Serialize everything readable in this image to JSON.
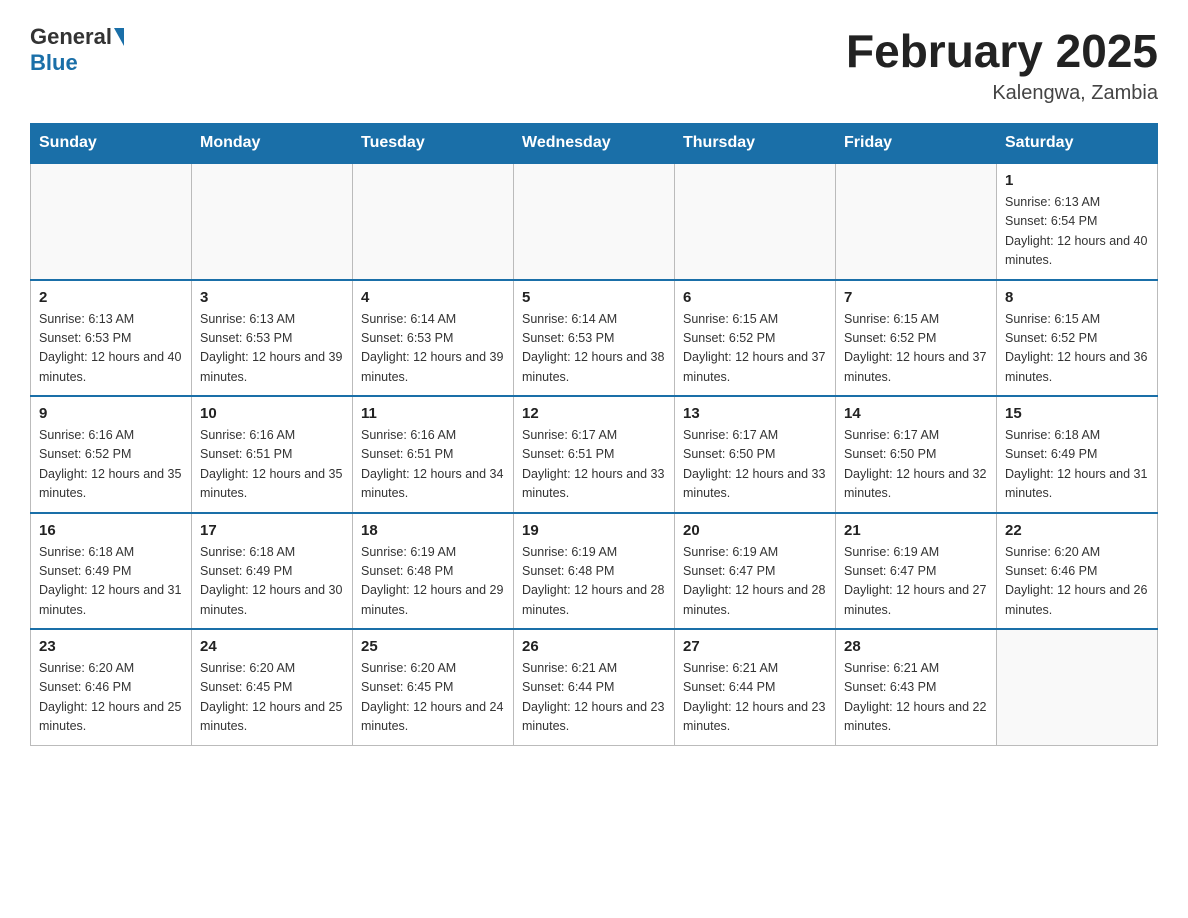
{
  "header": {
    "logo_general": "General",
    "logo_blue": "Blue",
    "month_title": "February 2025",
    "subtitle": "Kalengwa, Zambia"
  },
  "days_of_week": [
    "Sunday",
    "Monday",
    "Tuesday",
    "Wednesday",
    "Thursday",
    "Friday",
    "Saturday"
  ],
  "weeks": [
    [
      {
        "day": "",
        "info": ""
      },
      {
        "day": "",
        "info": ""
      },
      {
        "day": "",
        "info": ""
      },
      {
        "day": "",
        "info": ""
      },
      {
        "day": "",
        "info": ""
      },
      {
        "day": "",
        "info": ""
      },
      {
        "day": "1",
        "info": "Sunrise: 6:13 AM\nSunset: 6:54 PM\nDaylight: 12 hours and 40 minutes."
      }
    ],
    [
      {
        "day": "2",
        "info": "Sunrise: 6:13 AM\nSunset: 6:53 PM\nDaylight: 12 hours and 40 minutes."
      },
      {
        "day": "3",
        "info": "Sunrise: 6:13 AM\nSunset: 6:53 PM\nDaylight: 12 hours and 39 minutes."
      },
      {
        "day": "4",
        "info": "Sunrise: 6:14 AM\nSunset: 6:53 PM\nDaylight: 12 hours and 39 minutes."
      },
      {
        "day": "5",
        "info": "Sunrise: 6:14 AM\nSunset: 6:53 PM\nDaylight: 12 hours and 38 minutes."
      },
      {
        "day": "6",
        "info": "Sunrise: 6:15 AM\nSunset: 6:52 PM\nDaylight: 12 hours and 37 minutes."
      },
      {
        "day": "7",
        "info": "Sunrise: 6:15 AM\nSunset: 6:52 PM\nDaylight: 12 hours and 37 minutes."
      },
      {
        "day": "8",
        "info": "Sunrise: 6:15 AM\nSunset: 6:52 PM\nDaylight: 12 hours and 36 minutes."
      }
    ],
    [
      {
        "day": "9",
        "info": "Sunrise: 6:16 AM\nSunset: 6:52 PM\nDaylight: 12 hours and 35 minutes."
      },
      {
        "day": "10",
        "info": "Sunrise: 6:16 AM\nSunset: 6:51 PM\nDaylight: 12 hours and 35 minutes."
      },
      {
        "day": "11",
        "info": "Sunrise: 6:16 AM\nSunset: 6:51 PM\nDaylight: 12 hours and 34 minutes."
      },
      {
        "day": "12",
        "info": "Sunrise: 6:17 AM\nSunset: 6:51 PM\nDaylight: 12 hours and 33 minutes."
      },
      {
        "day": "13",
        "info": "Sunrise: 6:17 AM\nSunset: 6:50 PM\nDaylight: 12 hours and 33 minutes."
      },
      {
        "day": "14",
        "info": "Sunrise: 6:17 AM\nSunset: 6:50 PM\nDaylight: 12 hours and 32 minutes."
      },
      {
        "day": "15",
        "info": "Sunrise: 6:18 AM\nSunset: 6:49 PM\nDaylight: 12 hours and 31 minutes."
      }
    ],
    [
      {
        "day": "16",
        "info": "Sunrise: 6:18 AM\nSunset: 6:49 PM\nDaylight: 12 hours and 31 minutes."
      },
      {
        "day": "17",
        "info": "Sunrise: 6:18 AM\nSunset: 6:49 PM\nDaylight: 12 hours and 30 minutes."
      },
      {
        "day": "18",
        "info": "Sunrise: 6:19 AM\nSunset: 6:48 PM\nDaylight: 12 hours and 29 minutes."
      },
      {
        "day": "19",
        "info": "Sunrise: 6:19 AM\nSunset: 6:48 PM\nDaylight: 12 hours and 28 minutes."
      },
      {
        "day": "20",
        "info": "Sunrise: 6:19 AM\nSunset: 6:47 PM\nDaylight: 12 hours and 28 minutes."
      },
      {
        "day": "21",
        "info": "Sunrise: 6:19 AM\nSunset: 6:47 PM\nDaylight: 12 hours and 27 minutes."
      },
      {
        "day": "22",
        "info": "Sunrise: 6:20 AM\nSunset: 6:46 PM\nDaylight: 12 hours and 26 minutes."
      }
    ],
    [
      {
        "day": "23",
        "info": "Sunrise: 6:20 AM\nSunset: 6:46 PM\nDaylight: 12 hours and 25 minutes."
      },
      {
        "day": "24",
        "info": "Sunrise: 6:20 AM\nSunset: 6:45 PM\nDaylight: 12 hours and 25 minutes."
      },
      {
        "day": "25",
        "info": "Sunrise: 6:20 AM\nSunset: 6:45 PM\nDaylight: 12 hours and 24 minutes."
      },
      {
        "day": "26",
        "info": "Sunrise: 6:21 AM\nSunset: 6:44 PM\nDaylight: 12 hours and 23 minutes."
      },
      {
        "day": "27",
        "info": "Sunrise: 6:21 AM\nSunset: 6:44 PM\nDaylight: 12 hours and 23 minutes."
      },
      {
        "day": "28",
        "info": "Sunrise: 6:21 AM\nSunset: 6:43 PM\nDaylight: 12 hours and 22 minutes."
      },
      {
        "day": "",
        "info": ""
      }
    ]
  ]
}
